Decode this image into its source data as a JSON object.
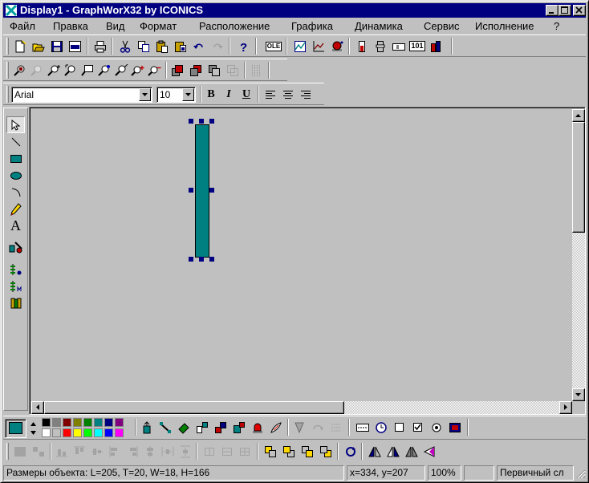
{
  "window": {
    "title": "Display1 - GraphWorX32 by ICONICS",
    "title_bar_color": "#000080",
    "caption_buttons": [
      "minimize-icon",
      "maximize-icon",
      "close-icon"
    ]
  },
  "menu": {
    "items": [
      {
        "label": "Файл",
        "icon": ""
      },
      {
        "label": "Правка",
        "icon": ""
      },
      {
        "label": "Вид",
        "icon": ""
      },
      {
        "label": "Формат",
        "icon": ""
      },
      {
        "label": "Расположение",
        "icon": ""
      },
      {
        "label": "Графика",
        "icon": ""
      },
      {
        "label": "Динамика",
        "icon": ""
      },
      {
        "label": "Сервис",
        "icon": ""
      },
      {
        "label": "Исполнение",
        "icon": ""
      },
      {
        "label": "?",
        "icon": ""
      }
    ]
  },
  "toolbar_standard": {
    "buttons": [
      "new-icon",
      "open-icon",
      "save-icon",
      "save-html-icon",
      "print-icon",
      "cut-icon",
      "copy-icon",
      "paste-icon",
      "paste-special-icon",
      "undo-icon",
      "redo-icon",
      "help-icon",
      "ole-icon",
      "trend-icon",
      "chart-icon",
      "alarm-icon",
      "gauge-icon",
      "slider-icon",
      "numeric-icon",
      "counter-icon",
      "bargraph-icon"
    ],
    "ole_label": "OLE",
    "numeric_label": "101"
  },
  "toolbar_zoom": {
    "buttons": [
      "zoom-window-icon",
      "zoom-previous-icon",
      "zoom-fit-icon",
      "zoom-object-icon",
      "zoom-select-icon",
      "zoom-point-icon",
      "zoom-percent-icon",
      "zoom-in-icon",
      "zoom-out-icon",
      "bring-front-icon",
      "send-back-icon",
      "group-icon",
      "ungroup-icon",
      "grid-icon"
    ]
  },
  "toolbar_font": {
    "font_name": "Arial",
    "font_size": "10",
    "bold_label": "B",
    "italic_label": "I",
    "underline_label": "U",
    "buttons": [
      "bold-icon",
      "italic-icon",
      "underline-icon",
      "align-left-icon",
      "align-center-icon",
      "align-right-icon"
    ]
  },
  "palette": {
    "tools": [
      "pointer-icon",
      "line-icon",
      "rectangle-icon",
      "ellipse-icon",
      "arc-icon",
      "pencil-icon",
      "text-icon",
      "symbol-icon",
      "dynamic-button-icon",
      "dynamic-mode-icon",
      "library-icon"
    ],
    "text_tool_label": "A",
    "active_tool": "pointer-icon"
  },
  "canvas": {
    "background": "#c0c0c0",
    "selected_object": {
      "type": "rectangle",
      "fill": "#008080",
      "L": 205,
      "T": 20,
      "W": 18,
      "H": 166
    }
  },
  "colorbar": {
    "current_color": "#008080",
    "swatches_row1": [
      "#000000",
      "#808080",
      "#800000",
      "#808000",
      "#008000",
      "#008080",
      "#000080",
      "#800080"
    ],
    "swatches_row2": [
      "#ffffff",
      "#c0c0c0",
      "#ff0000",
      "#ffff00",
      "#00ff00",
      "#00ffff",
      "#0000ff",
      "#ff00ff"
    ],
    "tools": [
      "fill-icon",
      "line-style-icon",
      "eraser-icon",
      "properties-icon",
      "pipe-icon",
      "color-change-icon",
      "alarm-light-icon",
      "brush-icon",
      "edit-point-icon",
      "rotate-icon",
      "grid-settings-icon",
      "datetime-icon",
      "checkbox-empty-icon",
      "checkbox-checked-icon",
      "radio-icon",
      "picture-icon"
    ]
  },
  "alignbar": {
    "tools": [
      "align-group-icon",
      "ungroup-align-icon",
      "align-bottom-icon",
      "align-top-icon",
      "align-middle-icon",
      "align-left-edge-icon",
      "align-right-edge-icon",
      "align-center-icon",
      "space-horizontal-icon",
      "space-vertical-icon",
      "same-width-icon",
      "same-height-icon",
      "same-size-icon",
      "layer-1-icon",
      "layer-2-icon",
      "layer-3-icon",
      "layer-4-icon",
      "refresh-icon",
      "flip-horizontal-icon",
      "flip-vertical-icon",
      "mirror-icon",
      "rotate-left-icon"
    ]
  },
  "status": {
    "object_size": "Размеры объекта: L=205, T=20, W=18, H=166",
    "coords": "x=334, y=207",
    "zoom": "100%",
    "extra": "",
    "mode": "Первичный сл"
  }
}
